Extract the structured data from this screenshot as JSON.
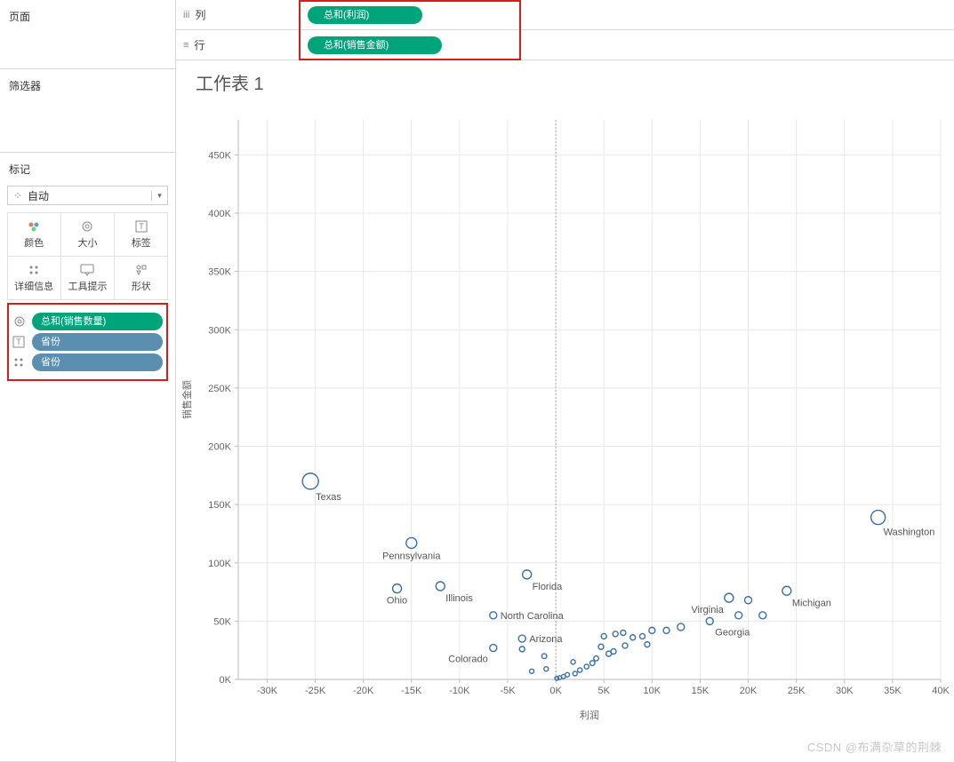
{
  "panels": {
    "pages": "页面",
    "filters": "筛选器",
    "marks": "标记"
  },
  "marks_dropdown": {
    "label": "自动"
  },
  "mark_cells": [
    {
      "label": "颜色",
      "name": "marks-color"
    },
    {
      "label": "大小",
      "name": "marks-size"
    },
    {
      "label": "标签",
      "name": "marks-label"
    },
    {
      "label": "详细信息",
      "name": "marks-detail"
    },
    {
      "label": "工具提示",
      "name": "marks-tooltip"
    },
    {
      "label": "形状",
      "name": "marks-shape"
    }
  ],
  "mark_drops": [
    {
      "icon": "size",
      "label": "总和(销售数量)",
      "color": "green",
      "name": "drop-size-sales-qty"
    },
    {
      "icon": "label",
      "label": "省份",
      "color": "blue",
      "name": "drop-label-province"
    },
    {
      "icon": "detail",
      "label": "省份",
      "color": "blue",
      "name": "drop-detail-province"
    }
  ],
  "shelves": {
    "columns": {
      "label": "列",
      "pill": "总和(利润)"
    },
    "rows": {
      "label": "行",
      "pill": "总和(销售金额)"
    }
  },
  "viz_title": "工作表 1",
  "watermark": "CSDN @布满杂草的荆棘",
  "chart_data": {
    "type": "scatter",
    "xlabel": "利润",
    "ylabel": "销售金额",
    "xlim": [
      -33000,
      40000
    ],
    "ylim": [
      0,
      480000
    ],
    "xticks": [
      -30000,
      -25000,
      -20000,
      -15000,
      -10000,
      -5000,
      0,
      5000,
      10000,
      15000,
      20000,
      25000,
      30000,
      35000,
      40000
    ],
    "xtick_labels": [
      "-30K",
      "-25K",
      "-20K",
      "-15K",
      "-10K",
      "-5K",
      "0K",
      "5K",
      "10K",
      "15K",
      "20K",
      "25K",
      "30K",
      "35K",
      "40K"
    ],
    "yticks": [
      0,
      50000,
      100000,
      150000,
      200000,
      250000,
      300000,
      350000,
      400000,
      450000
    ],
    "ytick_labels": [
      "0K",
      "50K",
      "100K",
      "150K",
      "200K",
      "250K",
      "300K",
      "350K",
      "400K",
      "450K"
    ],
    "points": [
      {
        "x": -25500,
        "y": 170000,
        "r": 9,
        "label": "Texas",
        "lpos": "br"
      },
      {
        "x": 33500,
        "y": 139000,
        "r": 8,
        "label": "Washington",
        "lpos": "br"
      },
      {
        "x": -15000,
        "y": 117000,
        "r": 6,
        "label": "Pennsylvania",
        "lpos": "b"
      },
      {
        "x": -3000,
        "y": 90000,
        "r": 5,
        "label": "Florida",
        "lpos": "br"
      },
      {
        "x": 18000,
        "y": 70000,
        "r": 5,
        "label": "Virginia",
        "lpos": "bl"
      },
      {
        "x": 24000,
        "y": 76000,
        "r": 5,
        "label": "Michigan",
        "lpos": "br"
      },
      {
        "x": -16500,
        "y": 78000,
        "r": 5,
        "label": "Ohio",
        "lpos": "b"
      },
      {
        "x": -12000,
        "y": 80000,
        "r": 5,
        "label": "Illinois",
        "lpos": "br"
      },
      {
        "x": -6500,
        "y": 55000,
        "r": 4,
        "label": "North Carolina",
        "lpos": "r"
      },
      {
        "x": -6500,
        "y": 27000,
        "r": 4,
        "label": "Colorado",
        "lpos": "bl"
      },
      {
        "x": -3500,
        "y": 35000,
        "r": 4,
        "label": "Arizona",
        "lpos": "r"
      },
      {
        "x": 16000,
        "y": 50000,
        "r": 4,
        "label": "Georgia",
        "lpos": "br"
      },
      {
        "x": 20000,
        "y": 68000,
        "r": 4
      },
      {
        "x": 21500,
        "y": 55000,
        "r": 4
      },
      {
        "x": 19000,
        "y": 55000,
        "r": 4
      },
      {
        "x": 13000,
        "y": 45000,
        "r": 4
      },
      {
        "x": 11500,
        "y": 42000,
        "r": 3.5
      },
      {
        "x": 10000,
        "y": 42000,
        "r": 3.5
      },
      {
        "x": 9500,
        "y": 30000,
        "r": 3
      },
      {
        "x": 9000,
        "y": 37000,
        "r": 3
      },
      {
        "x": 8000,
        "y": 36000,
        "r": 3
      },
      {
        "x": 7200,
        "y": 29000,
        "r": 3
      },
      {
        "x": 7000,
        "y": 40000,
        "r": 3
      },
      {
        "x": 6000,
        "y": 24000,
        "r": 3
      },
      {
        "x": 6200,
        "y": 39000,
        "r": 3
      },
      {
        "x": 5500,
        "y": 22000,
        "r": 3
      },
      {
        "x": 5000,
        "y": 37000,
        "r": 3
      },
      {
        "x": 4700,
        "y": 28000,
        "r": 3
      },
      {
        "x": 4200,
        "y": 18000,
        "r": 2.8
      },
      {
        "x": 3800,
        "y": 14000,
        "r": 2.8
      },
      {
        "x": 3200,
        "y": 11000,
        "r": 2.6
      },
      {
        "x": 2500,
        "y": 8000,
        "r": 2.6
      },
      {
        "x": 1800,
        "y": 15000,
        "r": 2.6
      },
      {
        "x": 2000,
        "y": 5000,
        "r": 2.5
      },
      {
        "x": 1200,
        "y": 4000,
        "r": 2.4
      },
      {
        "x": 800,
        "y": 2500,
        "r": 2.3
      },
      {
        "x": 400,
        "y": 1500,
        "r": 2.2
      },
      {
        "x": 100,
        "y": 900,
        "r": 2.2
      },
      {
        "x": -1000,
        "y": 9000,
        "r": 2.5
      },
      {
        "x": -2500,
        "y": 7000,
        "r": 2.5
      },
      {
        "x": -3500,
        "y": 26000,
        "r": 3
      },
      {
        "x": -1200,
        "y": 20000,
        "r": 2.8
      }
    ]
  }
}
